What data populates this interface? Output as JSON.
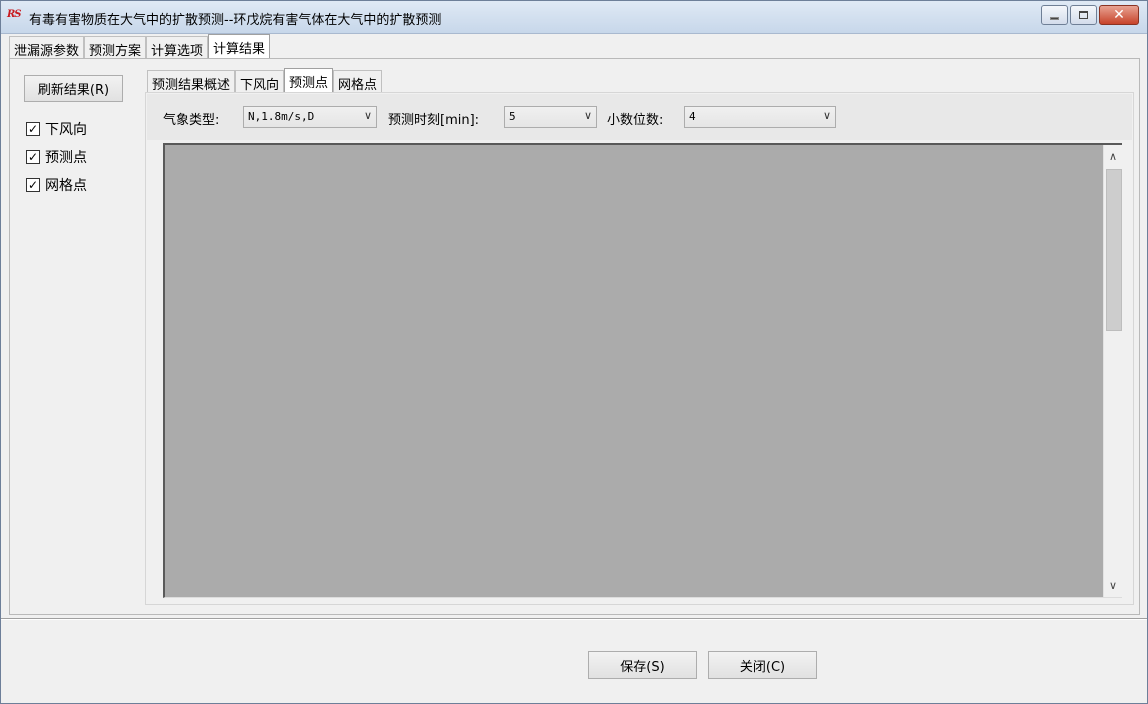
{
  "window": {
    "logo": "RS",
    "title": "有毒有害物质在大气中的扩散预测--环戊烷有害气体在大气中的扩散预测"
  },
  "main_tabs": [
    "泄漏源参数",
    "预测方案",
    "计算选项",
    "计算结果"
  ],
  "left": {
    "refresh_label": "刷新结果(R)",
    "checks": [
      {
        "label": "下风向",
        "checked": true
      },
      {
        "label": "预测点",
        "checked": true
      },
      {
        "label": "网格点",
        "checked": true
      }
    ]
  },
  "inner_tabs": [
    "预测结果概述",
    "下风向",
    "预测点",
    "网格点"
  ],
  "toolbar": {
    "weather_label": "气象类型:",
    "weather_value": "N,1.8m/s,D",
    "time_label": "预测时刻[min]:",
    "time_value": "5",
    "decimals_label": "小数位数:",
    "decimals_value": "4"
  },
  "footer": {
    "save_label": "保存(S)",
    "close_label": "关闭(C)"
  }
}
